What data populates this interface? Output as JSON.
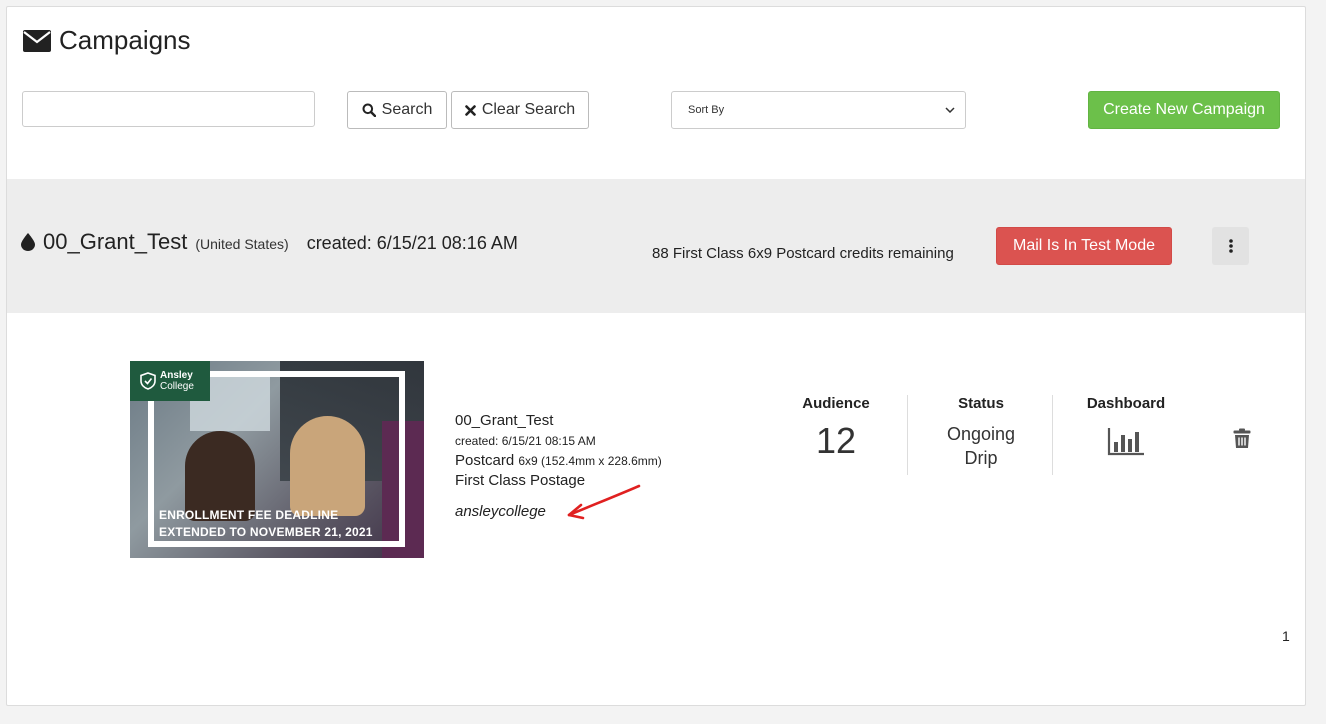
{
  "page": {
    "title": "Campaigns",
    "title_icon": "envelope-icon"
  },
  "toolbar": {
    "search_value": "",
    "search_label": "Search",
    "search_icon": "search-icon",
    "clear_label": "Clear Search",
    "clear_icon": "times-icon",
    "sort_label": "Sort By",
    "create_label": "Create New Campaign"
  },
  "campaign": {
    "icon": "drop-icon",
    "name": "00_Grant_Test",
    "country": "(United States)",
    "created": "created: 6/15/21 08:16 AM",
    "credits": "88 First Class 6x9 Postcard credits remaining",
    "mode_label": "Mail Is In Test Mode",
    "menu_icon": "kebab-menu-icon"
  },
  "piece": {
    "thumbnail": {
      "logo_line1": "Ansley",
      "logo_line2": "College",
      "caption_line1": "ENROLLMENT FEE DEADLINE",
      "caption_line2": "EXTENDED TO NOVEMBER 21, 2021"
    },
    "name": "00_Grant_Test",
    "created": "created: 6/15/21 08:15 AM",
    "product": "Postcard",
    "size": "6x9 (152.4mm x 228.6mm)",
    "postage": "First Class Postage",
    "account": "ansleycollege"
  },
  "stats": {
    "audience_label": "Audience",
    "audience_value": "12",
    "status_label": "Status",
    "status_line1": "Ongoing",
    "status_line2": "Drip",
    "dashboard_label": "Dashboard",
    "dashboard_icon": "bar-chart-icon"
  },
  "pagination": {
    "current": "1"
  },
  "colors": {
    "create_button": "#6cc04a",
    "test_mode_button": "#db5350",
    "campaign_header_bg": "#ededed",
    "annotation_arrow": "#e02020"
  }
}
